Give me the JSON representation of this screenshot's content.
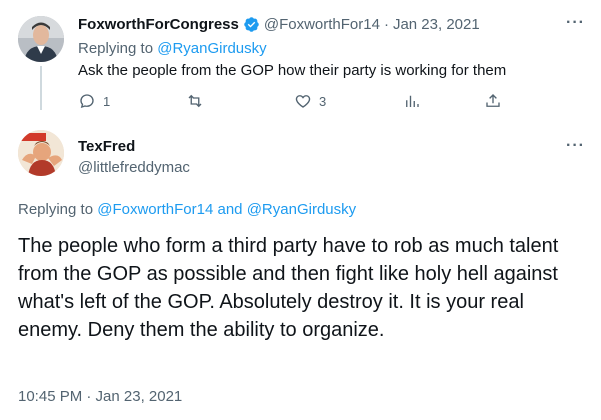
{
  "parent_tweet": {
    "display_name": "FoxworthForCongress",
    "handle": "@FoxworthFor14",
    "separator": "·",
    "date": "Jan 23, 2021",
    "replying_prefix": "Replying to",
    "replying_to": "@RyanGirdusky",
    "text": "Ask the people from the GOP how their party is working for them",
    "reply_count": "1",
    "retweet_count": "",
    "like_count": "3"
  },
  "main_tweet": {
    "display_name": "TexFred",
    "handle": "@littlefreddymac",
    "replying_prefix": "Replying to",
    "replying_user_1": "@FoxworthFor14",
    "replying_and": "and",
    "replying_user_2": "@RyanGirdusky",
    "text": "The people who form a third party have to rob as much talent from the GOP as possible and then fight like holy hell against what's left of the GOP. Absolutely destroy it. It is your real enemy. Deny them the ability to organize.",
    "time": "10:45 PM · Jan 23, 2021"
  },
  "colors": {
    "accent": "#1d9bf0",
    "muted": "#536471",
    "text": "#0f1419"
  },
  "icons": [
    "verified-badge-icon",
    "more-icon",
    "reply-icon",
    "retweet-icon",
    "like-icon",
    "views-icon",
    "share-icon"
  ]
}
